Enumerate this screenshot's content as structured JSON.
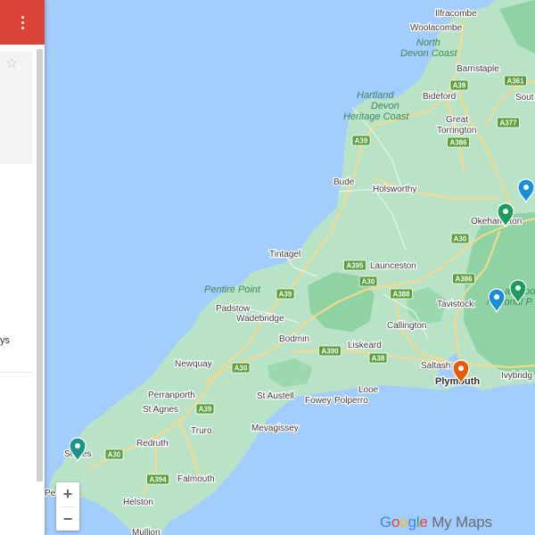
{
  "panel": {
    "menu_icon": "more-vert-icon",
    "star_icon": "star-outline-icon",
    "partial_text": "ys"
  },
  "zoom": {
    "in_label": "+",
    "out_label": "−"
  },
  "branding": {
    "part1": "Google",
    "part2": " My Maps"
  },
  "colors": {
    "header": "#db4437",
    "sea": "#a3ccff",
    "land": "#b9e3c6",
    "park": "#8fd3a4",
    "road_shield": "#5aa13c",
    "marker_blue": "#1a8fd8",
    "marker_green": "#1e9b5e",
    "marker_teal": "#189488",
    "marker_orange": "#e8590c"
  },
  "places": [
    {
      "id": "ilfracombe",
      "name": "Ilfracombe"
    },
    {
      "id": "woolacombe",
      "name": "Woolacombe"
    },
    {
      "id": "barnstaple",
      "name": "Barnstaple"
    },
    {
      "id": "bideford",
      "name": "Bideford"
    },
    {
      "id": "south",
      "name": "Sout"
    },
    {
      "id": "great",
      "name": "Great"
    },
    {
      "id": "torrington",
      "name": "Torrington"
    },
    {
      "id": "bude",
      "name": "Bude"
    },
    {
      "id": "holsworthy",
      "name": "Holsworthy"
    },
    {
      "id": "okehampton",
      "name": "Okehampton"
    },
    {
      "id": "tintagel",
      "name": "Tintagel"
    },
    {
      "id": "launceston",
      "name": "Launceston"
    },
    {
      "id": "padstow",
      "name": "Padstow"
    },
    {
      "id": "wadebridge",
      "name": "Wadebridge"
    },
    {
      "id": "tavistock",
      "name": "Tavistock"
    },
    {
      "id": "bodmin",
      "name": "Bodmin"
    },
    {
      "id": "callington",
      "name": "Callington"
    },
    {
      "id": "liskeard",
      "name": "Liskeard"
    },
    {
      "id": "newquay",
      "name": "Newquay"
    },
    {
      "id": "saltash",
      "name": "Saltash"
    },
    {
      "id": "plymouth",
      "name": "Plymouth"
    },
    {
      "id": "ivybridge",
      "name": "Ivybridg"
    },
    {
      "id": "perranporth",
      "name": "Perranporth"
    },
    {
      "id": "st-austell",
      "name": "St Austell"
    },
    {
      "id": "looe",
      "name": "Looe"
    },
    {
      "id": "fowey",
      "name": "Fowey"
    },
    {
      "id": "polperro",
      "name": "Polperro"
    },
    {
      "id": "st-agnes",
      "name": "St Agnes"
    },
    {
      "id": "redruth",
      "name": "Redruth"
    },
    {
      "id": "truro",
      "name": "Truro"
    },
    {
      "id": "mevagissey",
      "name": "Mevagissey"
    },
    {
      "id": "st-ives",
      "name": "St Ives"
    },
    {
      "id": "falmouth",
      "name": "Falmouth"
    },
    {
      "id": "penzance",
      "name": "Pe"
    },
    {
      "id": "helston",
      "name": "Helston"
    },
    {
      "id": "mullion",
      "name": "Mullion"
    }
  ],
  "natural_features": [
    {
      "id": "north-devon-coast-1",
      "name": "North"
    },
    {
      "id": "north-devon-coast-2",
      "name": "Devon Coast"
    },
    {
      "id": "hartland-1",
      "name": "Hartland"
    },
    {
      "id": "hartland-2",
      "name": "Devon"
    },
    {
      "id": "hartland-3",
      "name": "Heritage Coast"
    },
    {
      "id": "pentire-point",
      "name": "Pentire Point"
    },
    {
      "id": "dartmoor-1",
      "name": "artmoo"
    },
    {
      "id": "dartmoor-2",
      "name": "National P"
    }
  ],
  "roads": [
    {
      "id": "a39-barnstaple",
      "ref": "A39"
    },
    {
      "id": "a361",
      "ref": "A361"
    },
    {
      "id": "a377",
      "ref": "A377"
    },
    {
      "id": "a386-north",
      "ref": "A386"
    },
    {
      "id": "a39-north-coast",
      "ref": "A39"
    },
    {
      "id": "a30-okehampton",
      "ref": "A30"
    },
    {
      "id": "a395",
      "ref": "A395"
    },
    {
      "id": "a30-launceston",
      "ref": "A30"
    },
    {
      "id": "a388",
      "ref": "A388"
    },
    {
      "id": "a386-tavistock",
      "ref": "A386"
    },
    {
      "id": "a39-wadebridge",
      "ref": "A39"
    },
    {
      "id": "a390-liskeard",
      "ref": "A390"
    },
    {
      "id": "a38",
      "ref": "A38"
    },
    {
      "id": "a30-newquay",
      "ref": "A30"
    },
    {
      "id": "a39-truro",
      "ref": "A39"
    },
    {
      "id": "a30-west",
      "ref": "A30"
    },
    {
      "id": "a394",
      "ref": "A394"
    }
  ],
  "markers": [
    {
      "id": "marker-north-devon",
      "color": "#1a8fd8",
      "icon": "map-pin-icon"
    },
    {
      "id": "marker-okehampton",
      "color": "#1e9b5e",
      "icon": "map-pin-icon"
    },
    {
      "id": "marker-dartmoor",
      "color": "#1e9b5e",
      "icon": "map-pin-icon"
    },
    {
      "id": "marker-tavistock",
      "color": "#1a8fd8",
      "icon": "map-pin-icon"
    },
    {
      "id": "marker-plymouth",
      "color": "#e8590c",
      "icon": "map-pin-icon"
    },
    {
      "id": "marker-st-ives",
      "color": "#189488",
      "icon": "map-pin-icon"
    }
  ]
}
